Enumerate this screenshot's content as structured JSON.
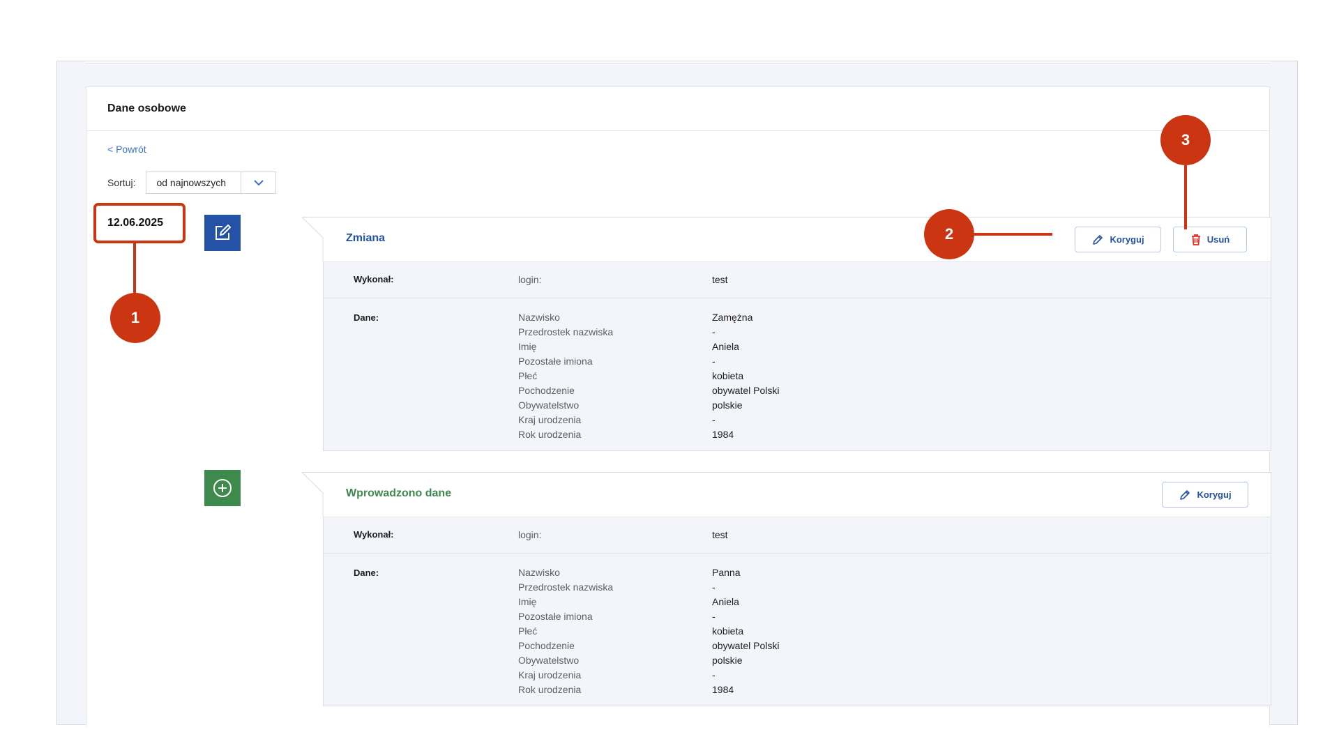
{
  "panel": {
    "title": "Dane osobowe"
  },
  "nav": {
    "back": "< Powrót"
  },
  "sort": {
    "label": "Sortuj:",
    "value": "od najnowszych"
  },
  "date": "12.06.2025",
  "colors": {
    "primary": "#2452a6",
    "success": "#3e8a4d",
    "callout": "#cc3511",
    "delete": "#d93025"
  },
  "events": [
    {
      "title": "Zmiana",
      "icon": "edit-icon",
      "actions": {
        "correct": "Koryguj",
        "delete": "Usuń"
      },
      "executor": {
        "label": "Wykonał:",
        "field": "login:",
        "value": "test"
      },
      "data_label": "Dane:",
      "fields": [
        {
          "name": "Nazwisko",
          "value": "Zamężna"
        },
        {
          "name": "Przedrostek nazwiska",
          "value": "-"
        },
        {
          "name": "Imię",
          "value": "Aniela"
        },
        {
          "name": "Pozostałe imiona",
          "value": "-"
        },
        {
          "name": "Płeć",
          "value": "kobieta"
        },
        {
          "name": "Pochodzenie",
          "value": "obywatel Polski"
        },
        {
          "name": "Obywatelstwo",
          "value": "polskie"
        },
        {
          "name": "Kraj urodzenia",
          "value": "-"
        },
        {
          "name": "Rok urodzenia",
          "value": "1984"
        }
      ]
    },
    {
      "title": "Wprowadzono dane",
      "icon": "add-circle-icon",
      "actions": {
        "correct": "Koryguj"
      },
      "executor": {
        "label": "Wykonał:",
        "field": "login:",
        "value": "test"
      },
      "data_label": "Dane:",
      "fields": [
        {
          "name": "Nazwisko",
          "value": "Panna"
        },
        {
          "name": "Przedrostek nazwiska",
          "value": "-"
        },
        {
          "name": "Imię",
          "value": "Aniela"
        },
        {
          "name": "Pozostałe imiona",
          "value": "-"
        },
        {
          "name": "Płeć",
          "value": "kobieta"
        },
        {
          "name": "Pochodzenie",
          "value": "obywatel Polski"
        },
        {
          "name": "Obywatelstwo",
          "value": "polskie"
        },
        {
          "name": "Kraj urodzenia",
          "value": "-"
        },
        {
          "name": "Rok urodzenia",
          "value": "1984"
        }
      ]
    }
  ],
  "callouts": [
    "1",
    "2",
    "3"
  ]
}
